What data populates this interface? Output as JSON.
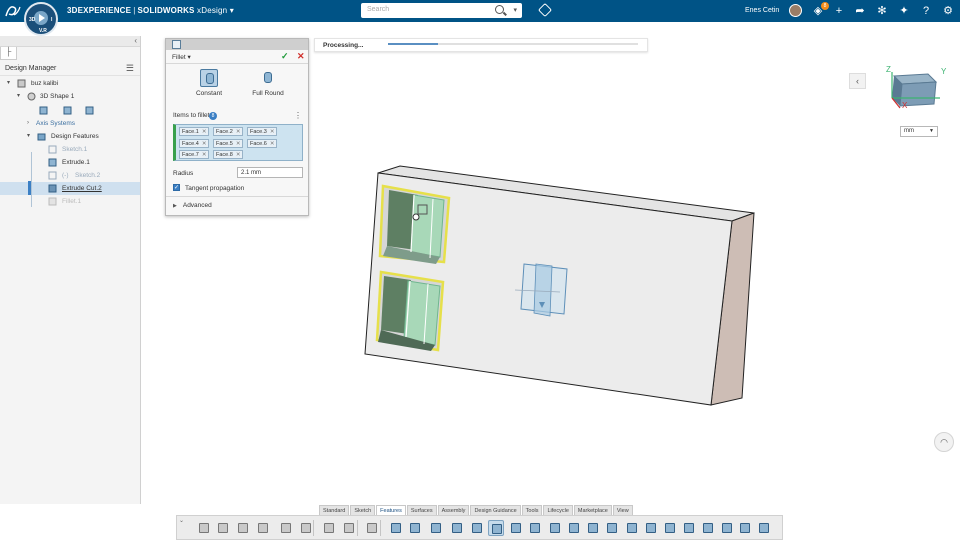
{
  "topbar": {
    "brand_bold": "3DEXPERIENCE",
    "brand_rest": "SOLIDWORKS",
    "app_name": "xDesign",
    "compass_labels": [
      "3D",
      "V.R",
      "I"
    ],
    "search_placeholder": "Search",
    "user_name": "Enes Cetin",
    "notification_count": "8"
  },
  "left_panel": {
    "title": "Design Manager",
    "tree": [
      {
        "label": "buz kalibi",
        "icon": "part-icon"
      },
      {
        "label": "3D Shape 1",
        "icon": "shape-icon"
      },
      {
        "label": "Axis Systems",
        "icon": "axis-icon"
      },
      {
        "label": "Design Features",
        "icon": "features-icon"
      },
      {
        "label": "Sketch.1",
        "icon": "sketch-icon"
      },
      {
        "label": "Extrude.1",
        "icon": "extrude-icon"
      },
      {
        "label": "Sketch.2",
        "icon": "sketch-icon"
      },
      {
        "label": "Extrude Cut.2",
        "icon": "extrude-cut-icon"
      },
      {
        "label": "Fillet.1",
        "icon": "fillet-icon"
      }
    ]
  },
  "fillet": {
    "title": "Fillet",
    "options": [
      "Constant",
      "Full Round"
    ],
    "items_label": "Items to fillet",
    "items_count": "8",
    "faces": [
      "Face.1",
      "Face.2",
      "Face.3",
      "Face.4",
      "Face.5",
      "Face.6",
      "Face.7",
      "Face.8"
    ],
    "radius_label": "Radius",
    "radius_value": "2.1 mm",
    "tangent_label": "Tangent propagation",
    "tangent_checked": true,
    "advanced_label": "Advanced"
  },
  "processing": {
    "label": "Processing...",
    "progress": 0.2
  },
  "viewport": {
    "units": "mm",
    "triad_labels": [
      "Z",
      "Y",
      "X"
    ]
  },
  "bottom_tabs": [
    "Standard",
    "Sketch",
    "Features",
    "Surfaces",
    "Assembly",
    "Design Guidance",
    "Tools",
    "Lifecycle",
    "Marketplace",
    "View"
  ],
  "active_tab": "Features",
  "colors": {
    "topbar": "#005386",
    "selection_highlight": "#e6e04a",
    "face_fill": "#6fb58f",
    "accent": "#3b7fc4"
  }
}
